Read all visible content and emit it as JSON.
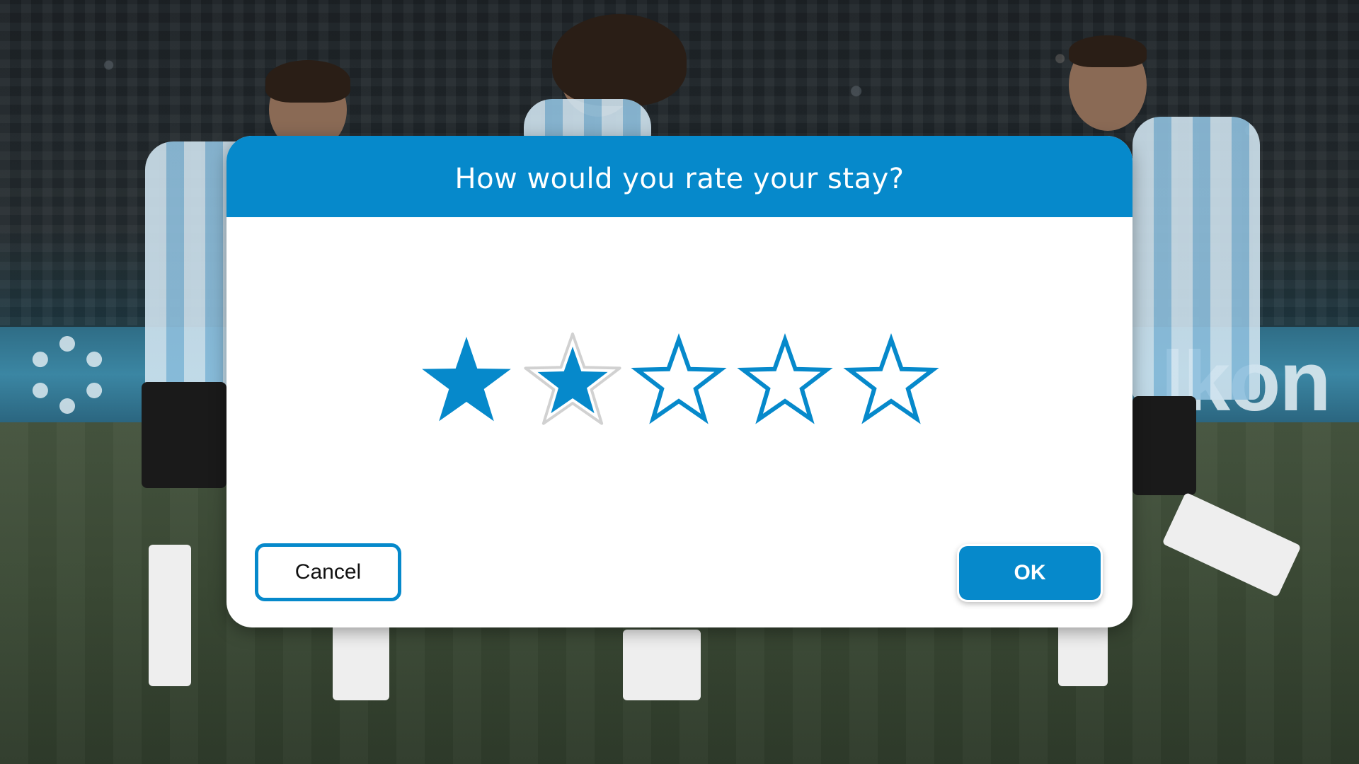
{
  "dialog": {
    "title": "How would you rate your stay?",
    "rating": {
      "max": 5,
      "value": 2,
      "focused_index": 2
    },
    "buttons": {
      "cancel_label": "Cancel",
      "ok_label": "OK"
    }
  },
  "background": {
    "ad_board_text": "lkon"
  },
  "colors": {
    "accent": "#0689cb",
    "dialog_bg": "#ffffff",
    "title_text": "#ffffff"
  },
  "icons": [
    "star-filled-icon",
    "star-outline-icon"
  ]
}
